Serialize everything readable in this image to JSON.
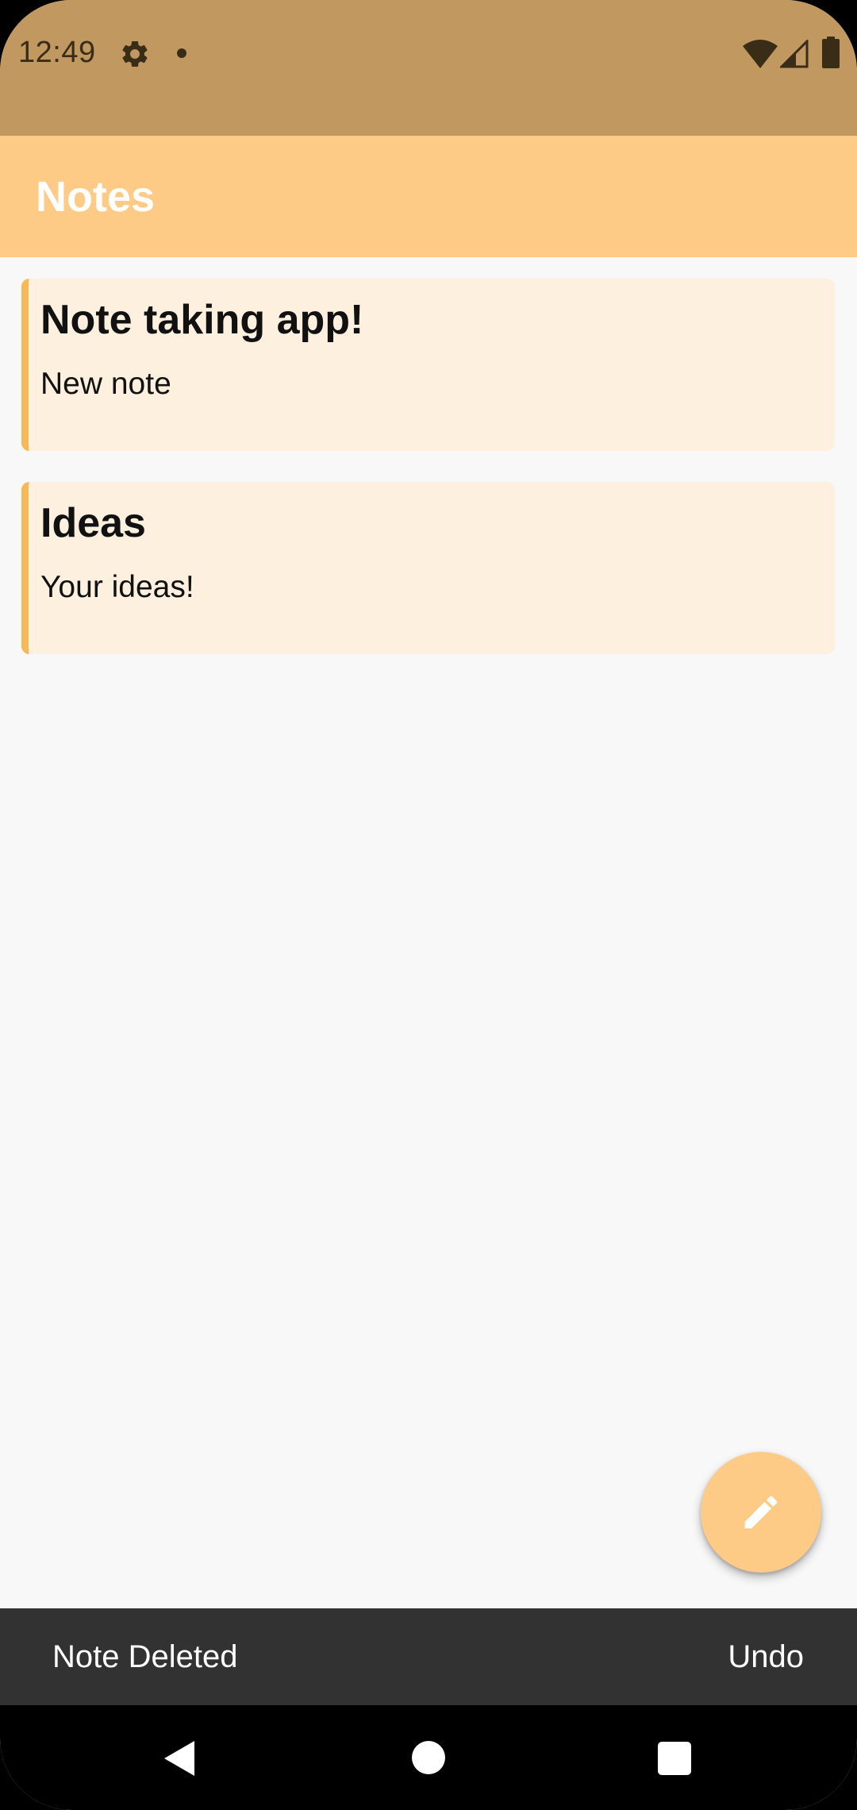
{
  "status_bar": {
    "time": "12:49",
    "icons": [
      "gear-icon",
      "notification-dot-icon",
      "wifi-icon",
      "signal-icon",
      "battery-icon"
    ]
  },
  "app_bar": {
    "title": "Notes"
  },
  "notes": [
    {
      "title": "Note taking app!",
      "body": "New note"
    },
    {
      "title": "Ideas",
      "body": "Your ideas!"
    }
  ],
  "fab": {
    "icon": "pencil-icon"
  },
  "snackbar": {
    "message": "Note Deleted",
    "action": "Undo"
  },
  "nav_bar": {
    "icons": [
      "back-icon",
      "home-icon",
      "recents-icon"
    ]
  },
  "colors": {
    "status_bar": "#c09860",
    "app_bar": "#fdcb85",
    "card_background": "#fdf0de",
    "card_accent": "#f6b955",
    "snackbar": "#323232"
  }
}
